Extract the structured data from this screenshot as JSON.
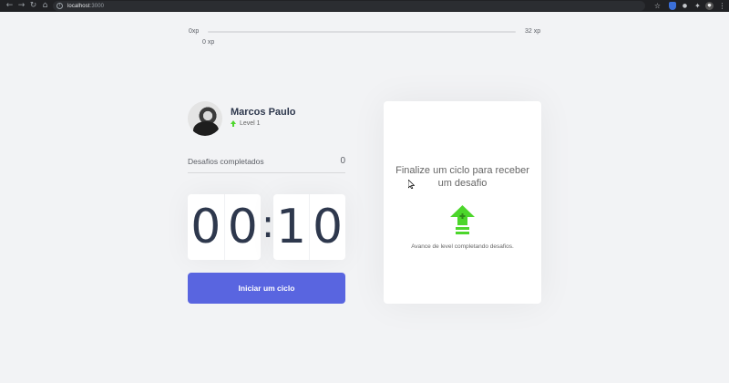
{
  "browser": {
    "url_host": "localhost",
    "url_port": ":3000"
  },
  "xp": {
    "min_label": "0xp",
    "max_label": "32 xp",
    "current_label": "0 xp",
    "progress_fraction": 0
  },
  "profile": {
    "name": "Marcos Paulo",
    "level": "Level 1"
  },
  "challenges": {
    "label": "Desafios completados",
    "count": "0"
  },
  "countdown": {
    "minute_left": "0",
    "minute_right": "0",
    "separator": ":",
    "second_left": "1",
    "second_right": "0"
  },
  "start_button_label": "Iniciar um ciclo",
  "challenge_card": {
    "title": "Finalize um ciclo para receber um desafio",
    "text": "Avance de level completando desafios."
  },
  "colors": {
    "accent_blue": "#5965e0",
    "accent_green": "#4cd62b",
    "text_dark": "#2e384d",
    "background": "#f2f3f5"
  },
  "icons": [
    "back-icon",
    "forward-icon",
    "reload-icon",
    "home-icon",
    "info-icon",
    "star-icon",
    "extension-shield-icon",
    "puzzle-icon",
    "profile-icon",
    "menu-icon",
    "level-up-icon"
  ]
}
